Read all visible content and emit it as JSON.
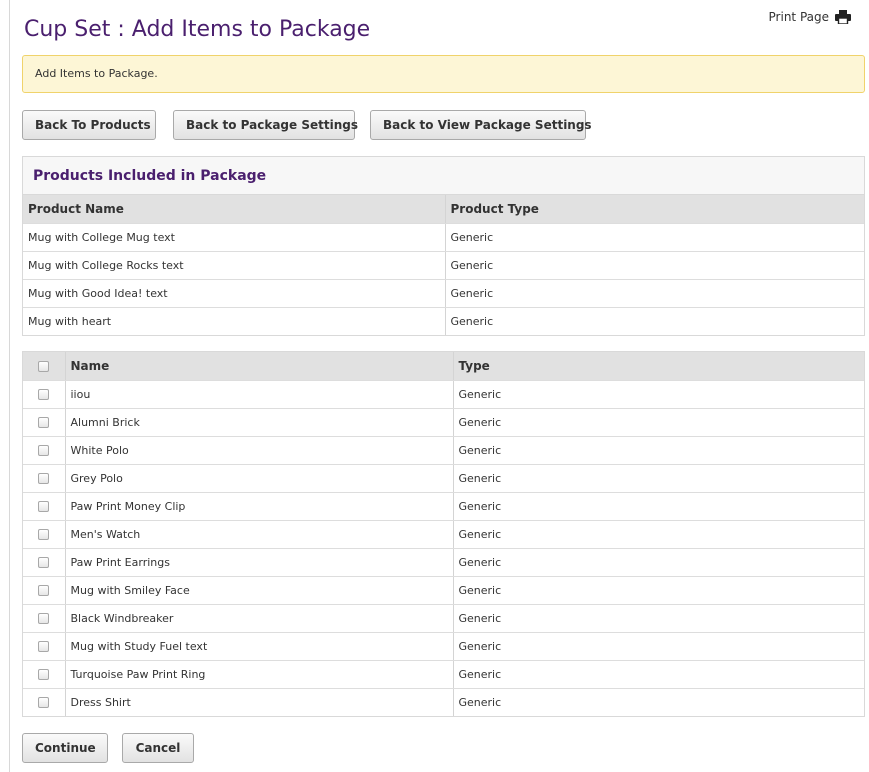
{
  "header": {
    "title": "Cup Set : Add Items to Package",
    "print_label": "Print Page",
    "print_icon": "printer-icon"
  },
  "notice": {
    "text": "Add Items to Package."
  },
  "nav_buttons": {
    "back_to_products": "Back To Products",
    "back_to_package_settings": "Back to Package Settings",
    "back_to_view_package_settings": "Back to View Package Settings"
  },
  "included": {
    "heading": "Products Included in Package",
    "columns": [
      "Product Name",
      "Product Type"
    ],
    "rows": [
      {
        "name": "Mug with College Mug text",
        "type": "Generic"
      },
      {
        "name": "Mug with College Rocks text",
        "type": "Generic"
      },
      {
        "name": "Mug with Good Idea! text",
        "type": "Generic"
      },
      {
        "name": "Mug with heart",
        "type": "Generic"
      }
    ]
  },
  "available": {
    "columns": [
      "Name",
      "Type"
    ],
    "rows": [
      {
        "name": "iiou",
        "type": "Generic",
        "checked": false
      },
      {
        "name": "Alumni Brick",
        "type": "Generic",
        "checked": false
      },
      {
        "name": "White Polo",
        "type": "Generic",
        "checked": false
      },
      {
        "name": "Grey Polo",
        "type": "Generic",
        "checked": false
      },
      {
        "name": "Paw Print Money Clip",
        "type": "Generic",
        "checked": false
      },
      {
        "name": "Men's Watch",
        "type": "Generic",
        "checked": false
      },
      {
        "name": "Paw Print Earrings",
        "type": "Generic",
        "checked": false
      },
      {
        "name": "Mug with Smiley Face",
        "type": "Generic",
        "checked": false
      },
      {
        "name": "Black Windbreaker",
        "type": "Generic",
        "checked": false
      },
      {
        "name": "Mug with Study Fuel text",
        "type": "Generic",
        "checked": false
      },
      {
        "name": "Turquoise Paw Print Ring",
        "type": "Generic",
        "checked": false
      },
      {
        "name": "Dress Shirt",
        "type": "Generic",
        "checked": false
      }
    ]
  },
  "actions": {
    "continue_label": "Continue",
    "cancel_label": "Cancel"
  },
  "colors": {
    "accent": "#4a1f6e",
    "notice_bg": "#fdf6d6",
    "notice_border": "#f0d36b",
    "header_bg": "#e1e1e1"
  }
}
